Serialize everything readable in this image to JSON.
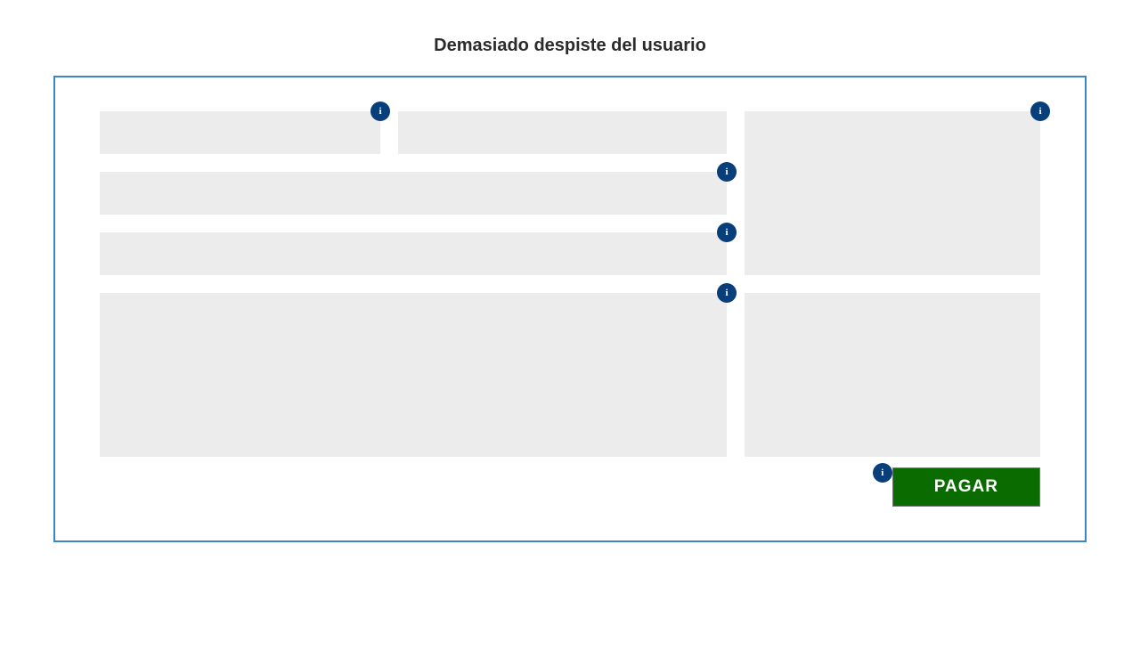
{
  "title": "Demasiado despiste del usuario",
  "info_glyph": "i",
  "pay_label": "PAGAR"
}
